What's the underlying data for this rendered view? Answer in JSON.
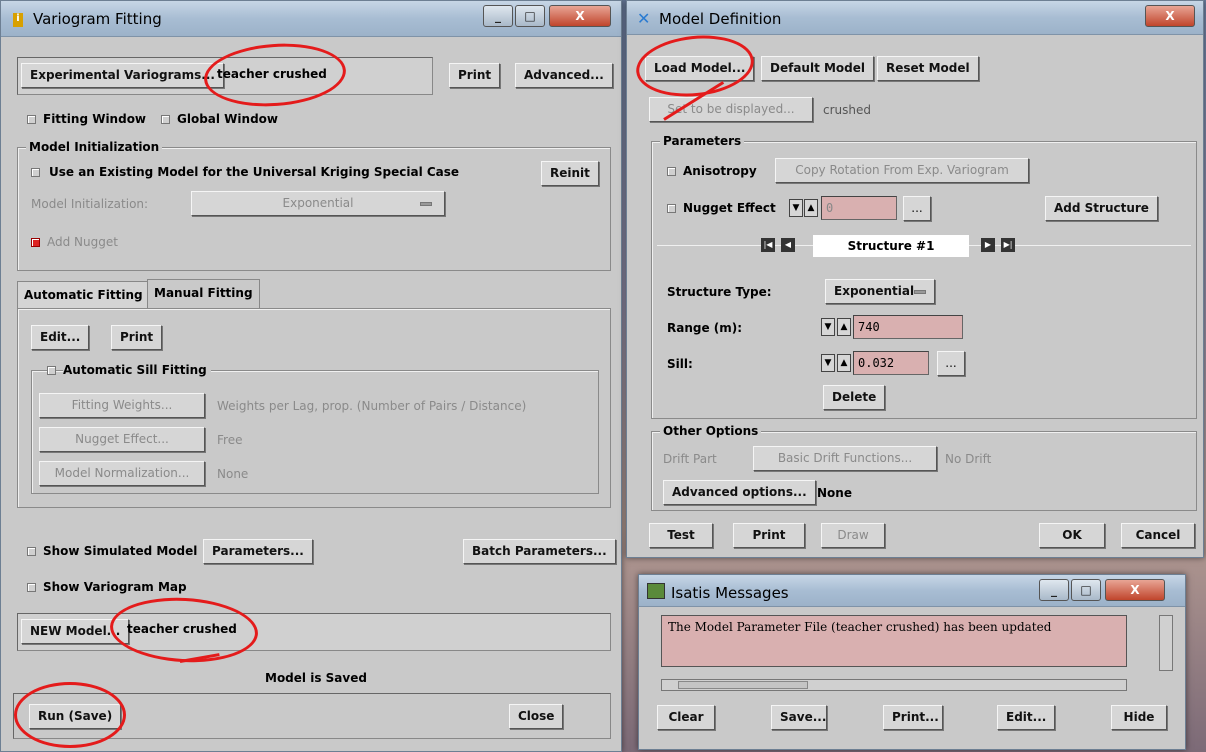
{
  "variogram": {
    "title": "Variogram Fitting",
    "exp_btn": "Experimental Variograms...",
    "exp_value": "teacher crushed",
    "print": "Print",
    "advanced": "Advanced...",
    "fitting_window": "Fitting Window",
    "global_window": "Global Window",
    "model_init_group": "Model Initialization",
    "use_existing": "Use an Existing Model for the Universal Kriging Special Case",
    "reinit": "Reinit",
    "model_init_label": "Model Initialization:",
    "model_init_value": "Exponential",
    "add_nugget": "Add Nugget",
    "tab_auto": "Automatic Fitting",
    "tab_manual": "Manual Fitting",
    "edit": "Edit...",
    "print2": "Print",
    "auto_sill": "Automatic Sill Fitting",
    "fitting_weights": "Fitting Weights...",
    "fitting_weights_value": "Weights per Lag, prop. (Number of Pairs / Distance)",
    "nugget_effect": "Nugget Effect...",
    "nugget_value": "Free",
    "model_norm": "Model Normalization...",
    "model_norm_value": "None",
    "show_sim": "Show Simulated Model",
    "parameters": "Parameters...",
    "batch": "Batch Parameters...",
    "show_map": "Show Variogram Map",
    "new_model": "NEW Model...",
    "new_model_value": "teacher crushed",
    "status": "Model is Saved",
    "run": "Run (Save)",
    "close": "Close"
  },
  "model_def": {
    "title": "Model Definition",
    "load": "Load Model...",
    "default": "Default Model",
    "reset": "Reset Model",
    "set_display": "Set to be displayed...",
    "set_display_value": "crushed",
    "params_group": "Parameters",
    "anisotropy": "Anisotropy",
    "copy_rotation": "Copy Rotation From Exp. Variogram",
    "nugget": "Nugget Effect",
    "nugget_value": "0",
    "dots": "...",
    "add_structure": "Add Structure",
    "structure": "Structure #1",
    "structure_type_label": "Structure Type:",
    "structure_type_value": "Exponential",
    "range_label": "Range (m):",
    "range_value": "740",
    "sill_label": "Sill:",
    "sill_value": "0.032",
    "delete": "Delete",
    "other_group": "Other Options",
    "drift_part": "Drift Part",
    "basic_drift": "Basic Drift Functions...",
    "no_drift": "No Drift",
    "advanced_opts": "Advanced options...",
    "advanced_value": "None",
    "test": "Test",
    "print": "Print",
    "draw": "Draw",
    "ok": "OK",
    "cancel": "Cancel"
  },
  "messages": {
    "title": "Isatis Messages",
    "text": "The Model Parameter File (teacher crushed) has been updated",
    "clear": "Clear",
    "save": "Save...",
    "print": "Print...",
    "edit": "Edit...",
    "hide": "Hide"
  },
  "colors": {
    "annotation": "#e41b1b",
    "text_field": "#d9b0b0",
    "window": "#c9c9c9"
  }
}
